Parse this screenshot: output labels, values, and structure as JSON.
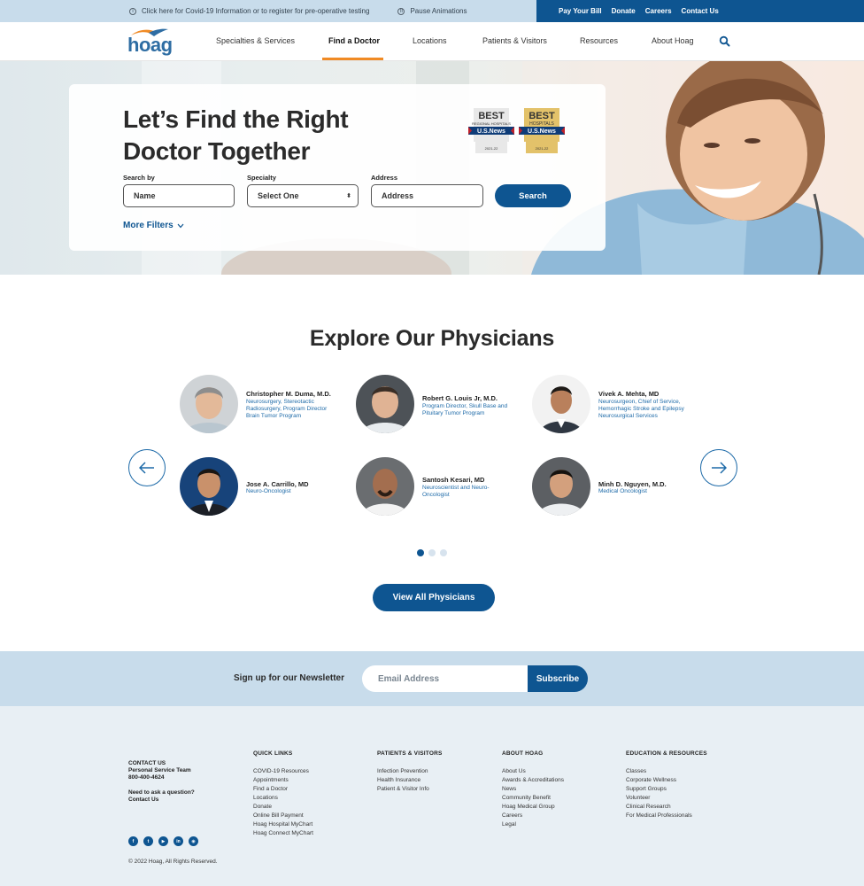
{
  "utility_bar": {
    "covid_text": "Click here for Covid-19 Information or to register for pre-operative testing",
    "pause_text": "Pause Animations",
    "links": [
      "Pay Your Bill",
      "Donate",
      "Careers",
      "Contact Us"
    ]
  },
  "brand": {
    "logo_text": "hoag"
  },
  "nav": {
    "items": [
      "Specialties & Services",
      "Find a Doctor",
      "Locations",
      "Patients & Visitors",
      "Resources",
      "About Hoag"
    ],
    "active": "Find a Doctor"
  },
  "hero": {
    "title": "Let’s Find the Right Doctor Together",
    "badges": [
      {
        "top": "BEST",
        "middle": "REGIONAL HOSPITALS",
        "brand": "U.S.News",
        "year": "2021-22"
      },
      {
        "top": "BEST",
        "middle": "HOSPITALS",
        "brand": "U.S.News",
        "year": "2021-22"
      }
    ],
    "search_by_label": "Search by",
    "name_placeholder": "Name",
    "specialty_label": "Specialty",
    "specialty_value": "Select One",
    "address_label": "Address",
    "address_placeholder": "Address",
    "search_button": "Search",
    "more_filters": "More Filters"
  },
  "physicians": {
    "title": "Explore Our Physicians",
    "list": [
      {
        "name": "Christopher M. Duma, M.D.",
        "specialty": "Neurosurgery, Stereotactic Radiosurgery, Program Director Brain Tumor Program"
      },
      {
        "name": "Robert G. Louis Jr, M.D.",
        "specialty": "Program Director, Skull Base and Pituitary Tumor Program"
      },
      {
        "name": "Vivek A. Mehta, MD",
        "specialty": "Neurosurgeon, Chief of Service, Hemorrhagic Stroke and Epilepsy Neurosurgical Services"
      },
      {
        "name": "Jose A. Carrillo, MD",
        "specialty": "Neuro-Oncologist"
      },
      {
        "name": "Santosh Kesari, MD",
        "specialty": "Neuroscientist and Neuro-Oncologist"
      },
      {
        "name": "Minh D. Nguyen, M.D.",
        "specialty": "Medical Oncologist"
      }
    ],
    "view_all": "View All Physicians",
    "pages": 3,
    "current_page": 1
  },
  "newsletter": {
    "label": "Sign up for our Newsletter",
    "email_placeholder": "Email Address",
    "button": "Subscribe"
  },
  "footer": {
    "contact": {
      "heading": "CONTACT US",
      "team": "Personal Service Team",
      "phone": "800-400-4624",
      "question": "Need to ask a question?",
      "link": "Contact Us"
    },
    "columns": [
      {
        "title": "QUICK LINKS",
        "links": [
          "COVID-19 Resources",
          "Appointments",
          "Find a Doctor",
          "Locations",
          "Donate",
          "Online Bill Payment",
          "Hoag Hospital MyChart",
          "Hoag Connect MyChart"
        ]
      },
      {
        "title": "PATIENTS & VISITORS",
        "links": [
          "Infection Prevention",
          "Health Insurance",
          "Patient & Visitor Info"
        ]
      },
      {
        "title": "ABOUT HOAG",
        "links": [
          "About Us",
          "Awards & Accreditations",
          "News",
          "Community Benefit",
          "Hoag Medical Group",
          "Careers",
          "Legal"
        ]
      },
      {
        "title": "EDUCATION & RESOURCES",
        "links": [
          "Classes",
          "Corporate Wellness",
          "Support Groups",
          "Volunteer",
          "Clinical Research",
          "For Medical Professionals"
        ]
      }
    ],
    "socials": [
      "facebook-icon",
      "twitter-icon",
      "youtube-icon",
      "linkedin-icon",
      "instagram-icon"
    ],
    "copyright": "© 2022 Hoag, All Rights Reserved."
  },
  "colors": {
    "brand_blue": "#0e5591",
    "utility_bg": "#c8dceb",
    "accent_orange": "#f08a24",
    "link_blue": "#1d6aa8",
    "footer_bg": "#e8eff4"
  }
}
